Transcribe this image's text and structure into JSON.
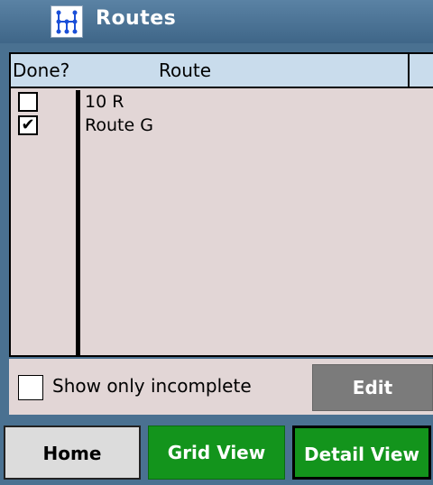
{
  "window": {
    "title": "Routes",
    "app_icon": "grid-icon"
  },
  "table": {
    "columns": [
      "Done?",
      "Route"
    ],
    "rows": [
      {
        "done": false,
        "route": "10 R"
      },
      {
        "done": true,
        "route": "Route G"
      }
    ]
  },
  "filter": {
    "label": "Show only incomplete",
    "checked": false
  },
  "edit_button": {
    "label": "Edit",
    "enabled": false
  },
  "nav": {
    "home": "Home",
    "grid_view": "Grid View",
    "detail_view": "Detail View",
    "active": "Detail View"
  },
  "colors": {
    "chrome": "#4a7191",
    "table_bg": "#e2d6d6",
    "header_bg": "#c9dcec",
    "nav_green": "#13941c",
    "disabled_gray": "#7b7b7b"
  }
}
